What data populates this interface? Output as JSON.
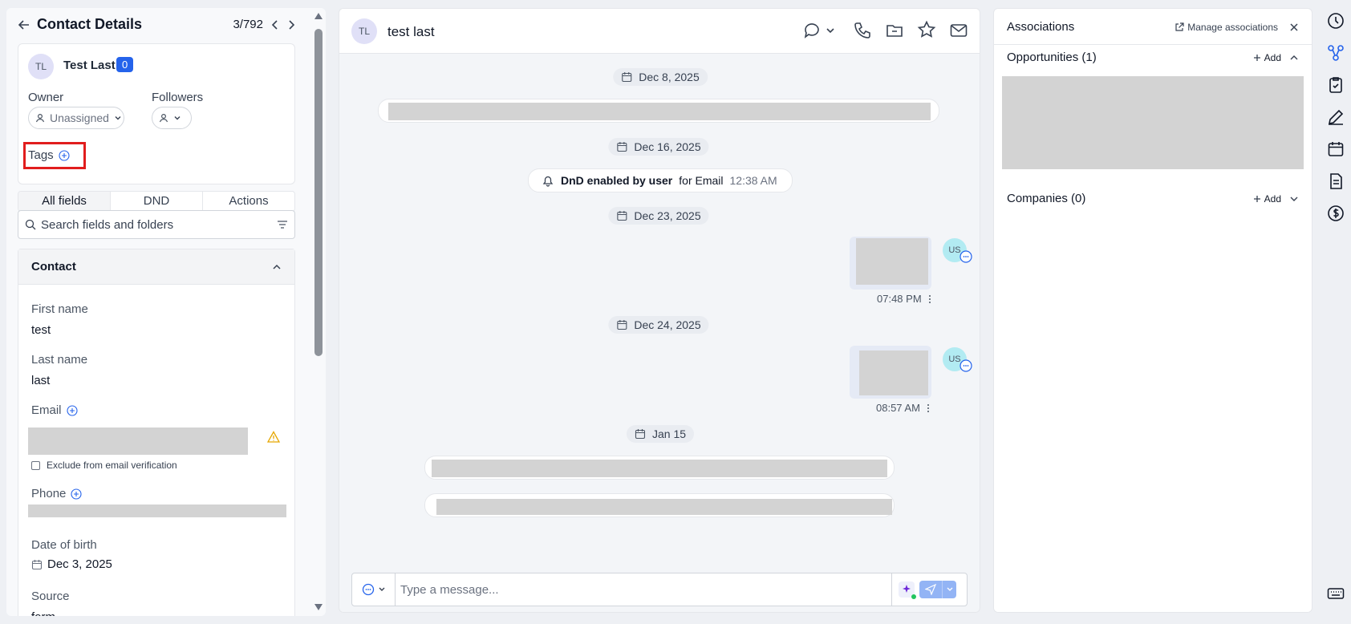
{
  "left": {
    "title": "Contact Details",
    "pager": "3/792",
    "contact": {
      "initials": "TL",
      "name": "Test Last",
      "badge": "0"
    },
    "owner_label": "Owner",
    "owner_value": "Unassigned",
    "followers_label": "Followers",
    "tags_label": "Tags",
    "tabs": [
      "All fields",
      "DND",
      "Actions"
    ],
    "search_placeholder": "Search fields and folders",
    "section_title": "Contact",
    "fields": {
      "first_name_label": "First name",
      "first_name_value": "test",
      "last_name_label": "Last name",
      "last_name_value": "last",
      "email_label": "Email",
      "exclude_label": "Exclude from email verification",
      "phone_label": "Phone",
      "dob_label": "Date of birth",
      "dob_value": "Dec 3, 2025",
      "source_label": "Source",
      "source_value": "form"
    }
  },
  "mid": {
    "initials": "TL",
    "name": "test last",
    "dates": [
      "Dec 8, 2025",
      "Dec 16, 2025",
      "Dec 23, 2025",
      "Dec 24, 2025",
      "Jan 15"
    ],
    "dnd_bold": "DnD enabled by user",
    "dnd_rest": "for Email",
    "dnd_time": "12:38 AM",
    "msg1_time": "07:48 PM",
    "msg2_time": "08:57 AM",
    "user_initials": "US",
    "composer_placeholder": "Type a message..."
  },
  "right": {
    "title": "Associations",
    "manage": "Manage associations",
    "opps": "Opportunities (1)",
    "companies": "Companies (0)",
    "add": "Add"
  },
  "colors": {
    "accent": "#2563eb",
    "highlight": "#e11d1d",
    "redact": "#d3d3d3"
  }
}
